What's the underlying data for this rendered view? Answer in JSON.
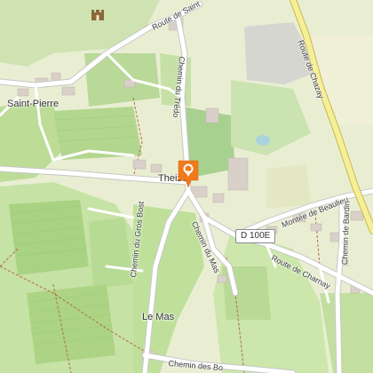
{
  "map": {
    "places": {
      "saint_pierre": "Saint-Pierre",
      "le_mas": "Le Mas",
      "marker_town": "Theizé"
    },
    "roads": {
      "route_de_saint": "Route de Saint",
      "chemin_du_tredo": "Chemin du Trédo",
      "route_de_chazay": "Route de Chazay",
      "chemin_du_gros_bost": "Chemin du Gros Bost",
      "chemin_du_mas": "Chemin du Mas",
      "montee_de_beaulieu": "Montée de Beaulieu",
      "chemin_de_bardin": "Chemin de Bardin",
      "route_de_charnay": "Route de Charnay",
      "chemin_des_bo": "Chemin des Bo"
    },
    "road_ref": "D 100E",
    "marker_color": "#f07a1c",
    "icons": {
      "marker": "map-pin-icon",
      "poi": "castle-icon"
    }
  }
}
